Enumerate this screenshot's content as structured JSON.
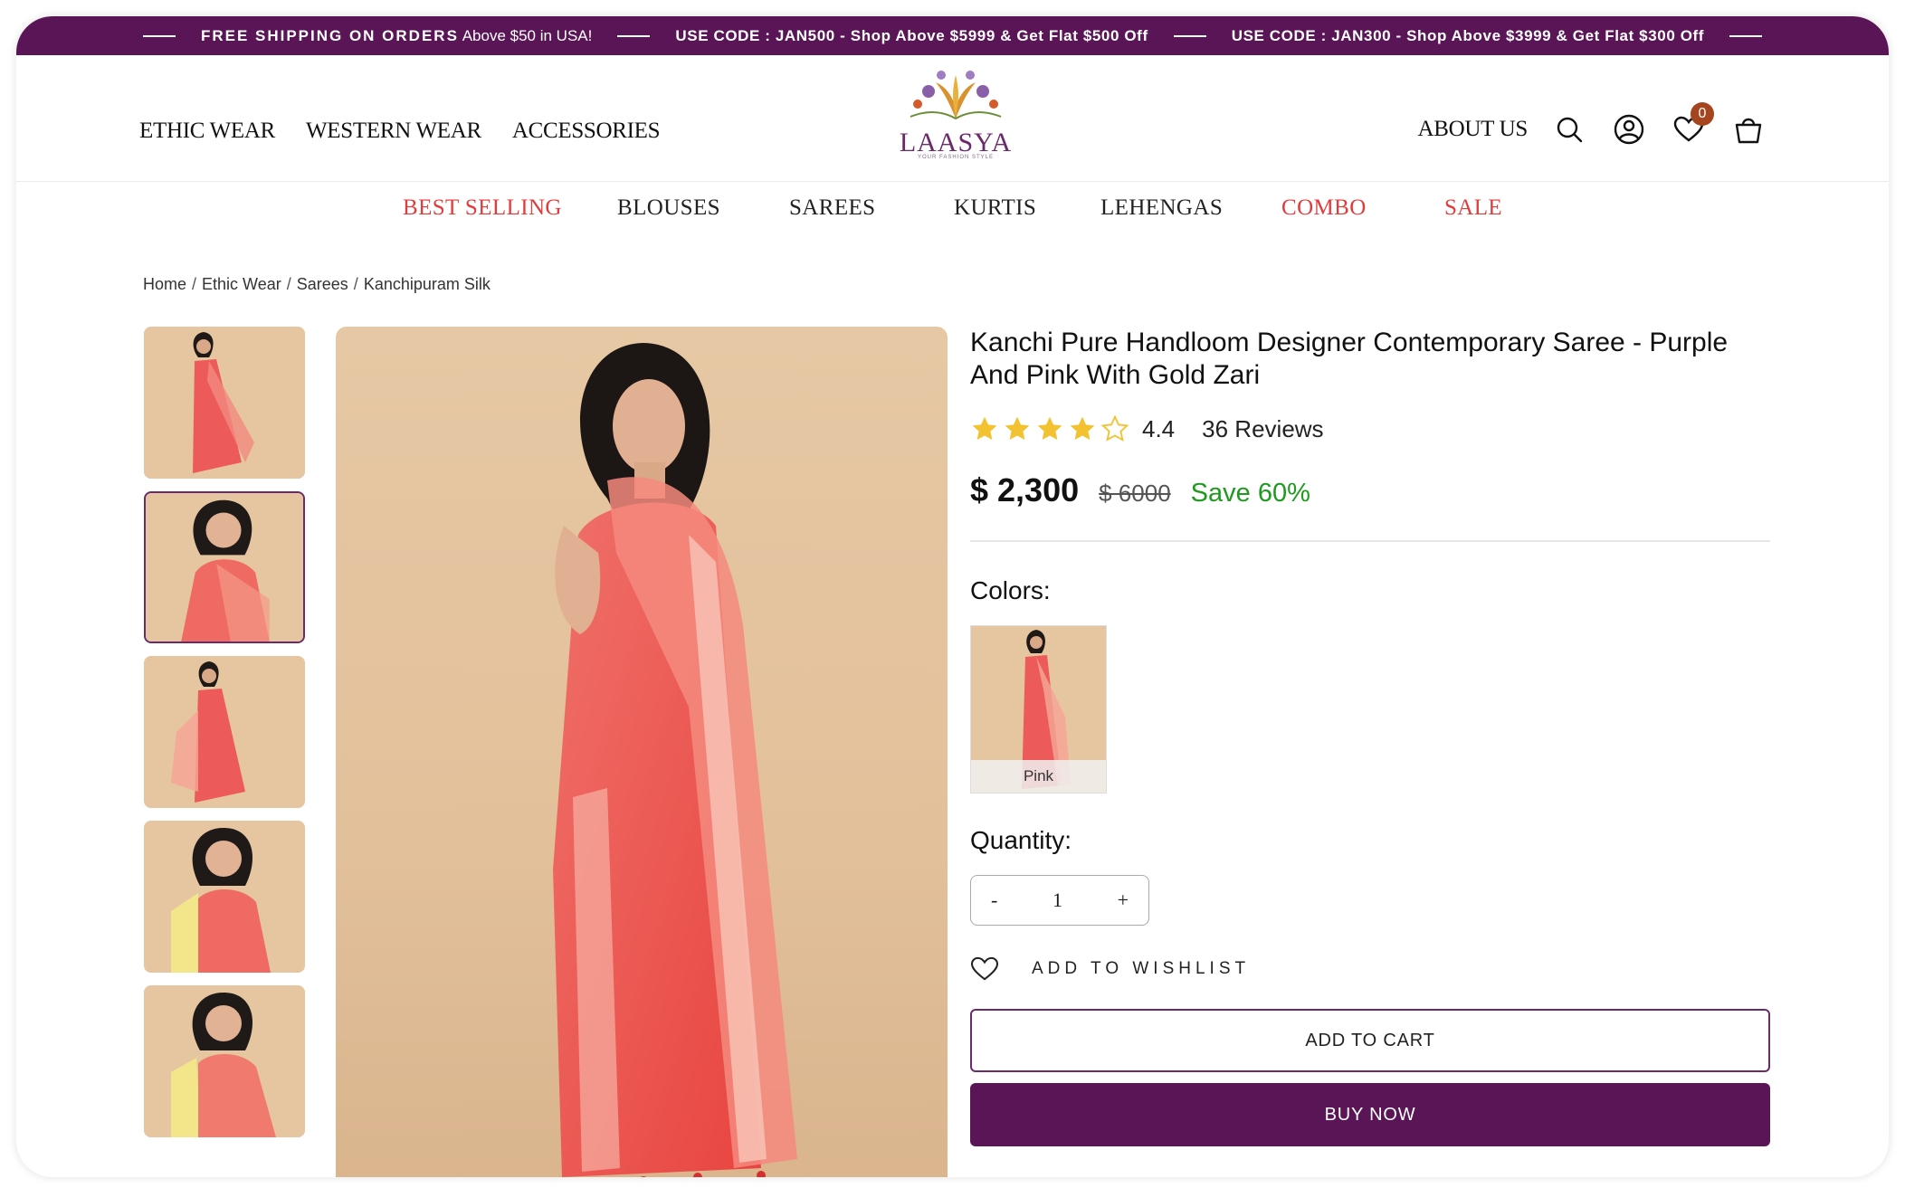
{
  "announcement": {
    "item1_bold": "FREE SHIPPING ON ORDERS",
    "item1_rest": "Above $50 in USA!",
    "item2": "USE CODE : JAN500 - Shop Above $5999 & Get Flat $500 Off",
    "item3": "USE CODE : JAN300 - Shop Above $3999 & Get Flat $300 Off"
  },
  "header": {
    "nav_left": [
      "ETHIC WEAR",
      "WESTERN WEAR",
      "ACCESSORIES"
    ],
    "logo_text": "LAASYA",
    "logo_sub": "YOUR FASHION STYLE",
    "about": "ABOUT US",
    "wishlist_count": "0"
  },
  "categories": [
    {
      "label": "BEST SELLING",
      "highlight": true
    },
    {
      "label": "BLOUSES",
      "highlight": false
    },
    {
      "label": "SAREES",
      "highlight": false
    },
    {
      "label": "KURTIS",
      "highlight": false
    },
    {
      "label": "LEHENGAS",
      "highlight": false
    },
    {
      "label": "COMBO",
      "highlight": true
    },
    {
      "label": "SALE",
      "highlight": true
    }
  ],
  "breadcrumb": [
    "Home",
    "Ethic Wear",
    "Sarees",
    "Kanchipuram Silk"
  ],
  "product": {
    "title": "Kanchi Pure Handloom Designer Contemporary Saree - Purple And Pink With Gold Zari",
    "rating": "4.4",
    "rating_stars": 4.4,
    "reviews": "36 Reviews",
    "price": "$ 2,300",
    "compare_price": "$ 6000",
    "save": "Save 60%",
    "colors_label": "Colors:",
    "color_option": "Pink",
    "quantity_label": "Quantity:",
    "quantity": "1",
    "qty_minus": "-",
    "qty_plus": "+",
    "wishlist": "ADD TO WISHLIST",
    "add_to_cart": "ADD TO CART",
    "buy_now": "BUY NOW"
  },
  "colors": {
    "brand": "#5a1557",
    "accent_red": "#e23b3b",
    "save_green": "#1f9a1f",
    "star": "#f2c230"
  }
}
